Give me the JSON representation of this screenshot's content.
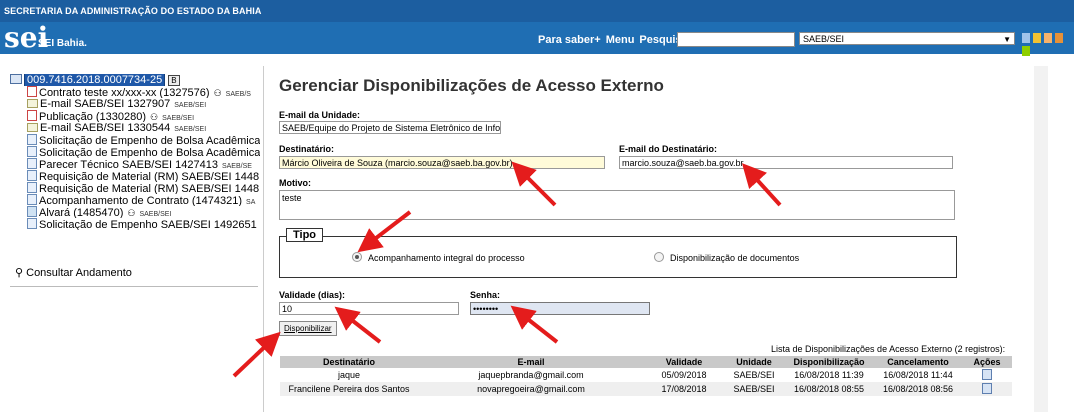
{
  "header": {
    "org_title": "SECRETARIA DA ADMINISTRAÇÃO DO ESTADO DA BAHIA",
    "logo": "sei",
    "logo_subtitle": "SEI Bahia.",
    "nav_links": [
      "Para saber+",
      "Menu",
      "Pesquisa"
    ],
    "search_value": "",
    "unit_selected": "SAEB/SEI"
  },
  "tree": {
    "process_number": "009.7416.2018.0007734-25",
    "process_badge": "B",
    "items": [
      {
        "label": "Contrato teste xx/xxx-xx (1327576)",
        "icon": "pdf-icon",
        "tag": "SAEB/S",
        "signed": true
      },
      {
        "label": "E-mail SAEB/SEI 1327907",
        "icon": "email-icon",
        "tag": "SAEB/SEI",
        "signed": false
      },
      {
        "label": "Publicação (1330280)",
        "icon": "pdf-icon",
        "tag": "SAEB/SEI",
        "signed": true
      },
      {
        "label": "E-mail SAEB/SEI 1330544",
        "icon": "email-icon",
        "tag": "SAEB/SEI",
        "signed": false
      },
      {
        "label": "Solicitação de Empenho de Bolsa Acadêmica",
        "icon": "document-icon",
        "tag": "",
        "signed": false
      },
      {
        "label": "Solicitação de Empenho de Bolsa Acadêmica",
        "icon": "document-icon",
        "tag": "",
        "signed": false
      },
      {
        "label": "Parecer Técnico SAEB/SEI 1427413",
        "icon": "document-icon",
        "tag": "SAEB/SE",
        "signed": false
      },
      {
        "label": "Requisição de Material (RM) SAEB/SEI 1448",
        "icon": "document-icon",
        "tag": "",
        "signed": false
      },
      {
        "label": "Requisição de Material (RM) SAEB/SEI 1448",
        "icon": "document-icon",
        "tag": "",
        "signed": false
      },
      {
        "label": "Acompanhamento de Contrato (1474321)",
        "icon": "document-icon",
        "tag": "SA",
        "signed": false
      },
      {
        "label": "Alvará (1485470)",
        "icon": "image-icon",
        "tag": "SAEB/SEI",
        "signed": true
      },
      {
        "label": "Solicitação de Empenho SAEB/SEI 1492651",
        "icon": "document-icon",
        "tag": "",
        "signed": false
      }
    ],
    "consult_label": "Consultar Andamento"
  },
  "form": {
    "title": "Gerenciar Disponibilizações de Acesso Externo",
    "unit_email_label": "E-mail da Unidade:",
    "unit_email_value": "SAEB/Equipe do Projeto de Sistema Eletrônico de Informações <seibahia@sae",
    "recipient_label": "Destinatário:",
    "recipient_value": "Márcio Oliveira de Souza (marcio.souza@saeb.ba.gov.br)",
    "recipient_email_label": "E-mail do Destinatário:",
    "recipient_email_value": "marcio.souza@saeb.ba.gov.br",
    "reason_label": "Motivo:",
    "reason_value": "teste",
    "type_legend": "Tipo",
    "type_option_full": "Acompanhamento integral do processo",
    "type_option_docs": "Disponibilização de documentos",
    "validity_label": "Validade (dias):",
    "validity_value": "10",
    "password_label": "Senha:",
    "password_value": "••••••••",
    "submit_label": "Disponibilizar"
  },
  "table": {
    "caption": "Lista de Disponibilizações de Acesso Externo (2 registros):",
    "columns": [
      "Destinatário",
      "E-mail",
      "Validade",
      "Unidade",
      "Disponibilização",
      "Cancelamento",
      "Ações"
    ],
    "rows": [
      [
        "jaque",
        "jaquepbranda@gmail.com",
        "05/09/2018",
        "SAEB/SEI",
        "16/08/2018 11:39",
        "16/08/2018 11:44"
      ],
      [
        "Francilene Pereira dos Santos",
        "novapregoeira@gmail.com",
        "17/08/2018",
        "SAEB/SEI",
        "16/08/2018 08:55",
        "16/08/2018 08:56"
      ]
    ]
  },
  "colors": {
    "header_blue": "#1f6eb3",
    "arrow_red": "#e41c1c"
  }
}
